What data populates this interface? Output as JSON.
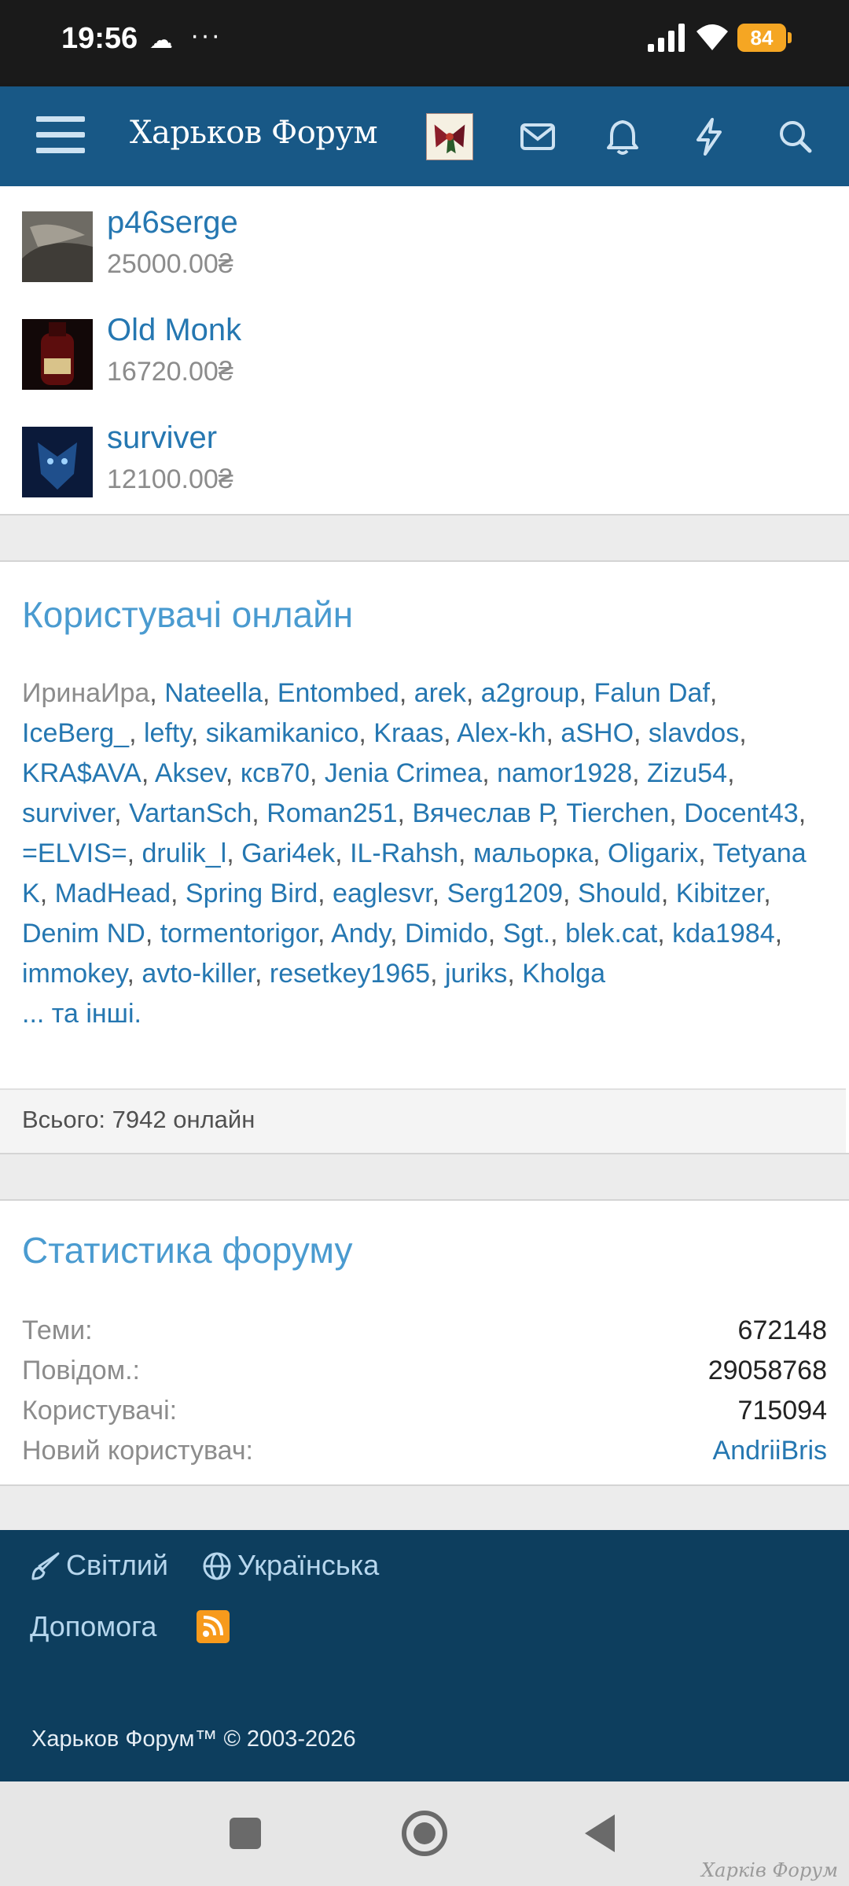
{
  "status_bar": {
    "time": "19:56",
    "battery": "84"
  },
  "header": {
    "brand": "Харьков Форум"
  },
  "top_members": [
    {
      "name": "p46serge",
      "amount": "25000.00₴"
    },
    {
      "name": "Old Monk",
      "amount": "16720.00₴"
    },
    {
      "name": "surviver",
      "amount": "12100.00₴"
    }
  ],
  "online": {
    "title": "Користувачі онлайн",
    "users": [
      "ИринаИра",
      "Nateella",
      "Entombed",
      "arek",
      "a2group",
      "Falun Daf",
      "IceBerg_",
      "lefty",
      "sikamikanico",
      "Kraas",
      "Alex-kh",
      "aSHO",
      "slavdos",
      "KRA$AVA",
      "Aksev",
      "ксв70",
      "Jenia Crimea",
      "namor1928",
      "Zizu54",
      "surviver",
      "VartanSch",
      "Roman251",
      "Вячеслав Р",
      "Tierchen",
      "Docent43",
      "=ELVIS=",
      "drulik_l",
      "Gari4ek",
      "IL-Rahsh",
      "мальорка",
      "Oligarix",
      "Tetyana K",
      "MadHead",
      "Spring Bird",
      "eaglesvr",
      "Serg1209",
      "Should",
      "Kibitzer",
      "Denim ND",
      "tormentorigor",
      "Andy",
      "Dimido",
      "Sgt.",
      "blek.cat",
      "kda1984",
      "immokey",
      "avto-killer",
      "resetkey1965",
      "juriks",
      "Kholga"
    ],
    "more": "... та інші.",
    "total": "Всього: 7942 онлайн"
  },
  "stats": {
    "title": "Статистика форуму",
    "rows": [
      {
        "label": "Теми:",
        "value": "672148"
      },
      {
        "label": "Повідом.:",
        "value": "29058768"
      },
      {
        "label": "Користувачі:",
        "value": "715094"
      },
      {
        "label": "Новий користувач:",
        "value": "AndriiBris"
      }
    ]
  },
  "footer": {
    "theme": "Світлий",
    "language": "Українська",
    "help": "Допомога",
    "copyright": "Харьков Форум™ © 2003-2026"
  },
  "watermark": "Харків Форум"
}
